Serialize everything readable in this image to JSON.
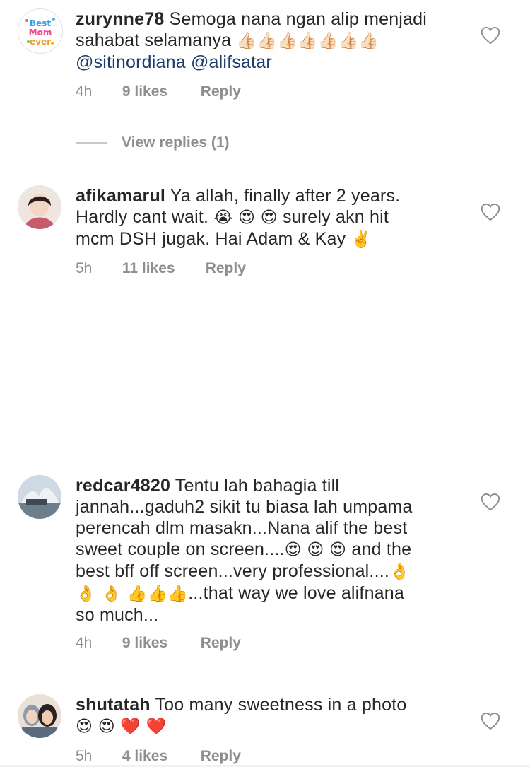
{
  "comments": [
    {
      "username": "zurynne78",
      "text": "Semoga nana ngan alip menjadi sahabat selamanya",
      "emoji_trail": "👍🏻👍🏻👍🏻👍🏻👍🏻👍🏻👍🏻",
      "mentions": "@sitinordiana @alifsatar",
      "time": "4h",
      "likes": "9 likes",
      "reply": "Reply",
      "avatar_text": [
        "Best",
        "Mom",
        "ever"
      ]
    },
    {
      "username": "afikamarul",
      "line1": "Ya allah, finally after 2 years.",
      "line2": "Hardly cant wait.",
      "line2_emoji": "😭 😍 😍",
      "line2_tail": "surely akn hit",
      "line3": "mcm DSH jugak. Hai Adam & Kay",
      "line3_emoji": "✌️",
      "time": "5h",
      "likes": "11 likes",
      "reply": "Reply"
    },
    {
      "username": "redcar4820",
      "line1": "Tentu lah bahagia till",
      "line2": "jannah...gaduh2 sikit tu biasa lah umpama",
      "line3": "perencah dlm masakn...Nana alif the best",
      "line4": "sweet couple on screen....",
      "line4_emoji": "😍 😍 😍",
      "line4_tail": "and the",
      "line5": "best bff off screen...very professional....",
      "line5_emoji": "👌",
      "line6_emoji": "👌 👌 👍👍👍",
      "line6_tail": "...that way we love alifnana",
      "line7": "so much...",
      "time": "4h",
      "likes": "9 likes",
      "reply": "Reply"
    },
    {
      "username": "shutatah",
      "line1": "Too many sweetness in a photo",
      "line2_emoji": "😍 😍 ❤️ ❤️",
      "time": "5h",
      "likes": "4 likes",
      "reply": "Reply"
    }
  ],
  "view_replies": "View replies (1)",
  "icons": {
    "like": "heart-outline-icon"
  },
  "colors": {
    "meta": "#8e8e8e",
    "mention": "#1f3b6b",
    "text": "#262626"
  }
}
